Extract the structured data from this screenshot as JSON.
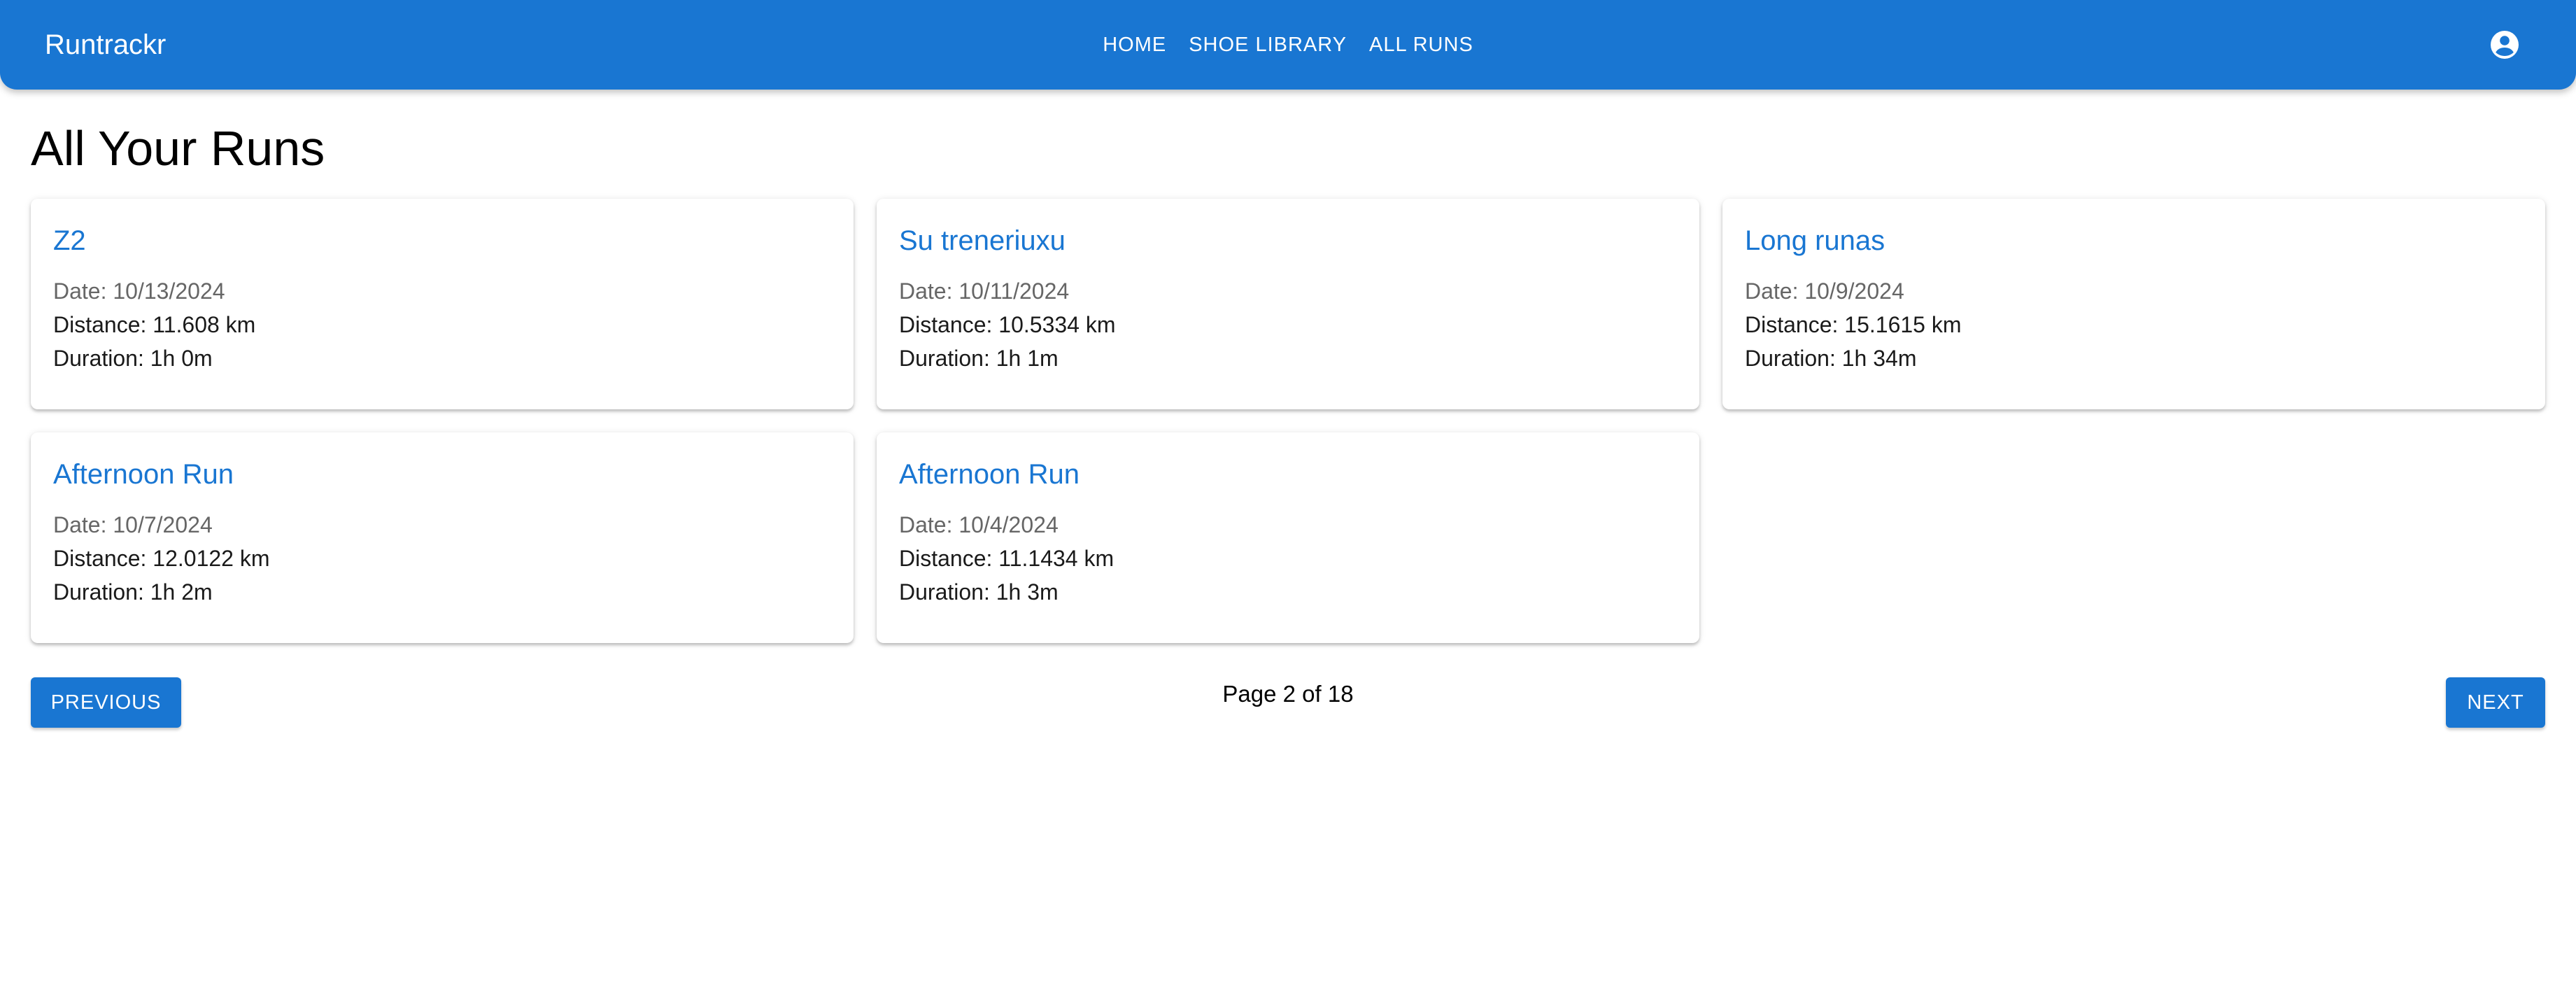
{
  "app": {
    "brand": "Runtrackr",
    "nav": [
      "HOME",
      "SHOE LIBRARY",
      "ALL RUNS"
    ],
    "account_icon": "account-circle-icon"
  },
  "page": {
    "title": "All Your Runs"
  },
  "runs": [
    {
      "name": "Z2",
      "date": "Date: 10/13/2024",
      "distance": "Distance: 11.608 km",
      "duration": "Duration: 1h 0m"
    },
    {
      "name": "Su treneriuxu",
      "date": "Date: 10/11/2024",
      "distance": "Distance: 10.5334 km",
      "duration": "Duration: 1h 1m"
    },
    {
      "name": "Long runas",
      "date": "Date: 10/9/2024",
      "distance": "Distance: 15.1615 km",
      "duration": "Duration: 1h 34m"
    },
    {
      "name": "Afternoon Run",
      "date": "Date: 10/7/2024",
      "distance": "Distance: 12.0122 km",
      "duration": "Duration: 1h 2m"
    },
    {
      "name": "Afternoon Run",
      "date": "Date: 10/4/2024",
      "distance": "Distance: 11.1434 km",
      "duration": "Duration: 1h 3m"
    }
  ],
  "pagination": {
    "previous_label": "PREVIOUS",
    "next_label": "NEXT",
    "indicator": "Page 2 of 18"
  },
  "colors": {
    "primary": "#1976d2",
    "date_text": "#666666"
  }
}
